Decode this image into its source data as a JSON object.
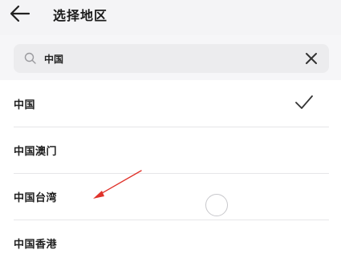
{
  "header": {
    "back_icon": "arrow-left-icon",
    "title": "选择地区"
  },
  "search": {
    "icon": "search-icon",
    "value": "中国",
    "clear_icon": "close-icon"
  },
  "regions": [
    {
      "label": "中国",
      "selected": true
    },
    {
      "label": "中国澳门",
      "selected": false
    },
    {
      "label": "中国台湾",
      "selected": false
    },
    {
      "label": "中国香港",
      "selected": false
    }
  ],
  "selected_indicator_icon": "checkmark-icon",
  "annotation": {
    "arrow_color": "#e0332b",
    "arrow_target": "中国台湾"
  }
}
